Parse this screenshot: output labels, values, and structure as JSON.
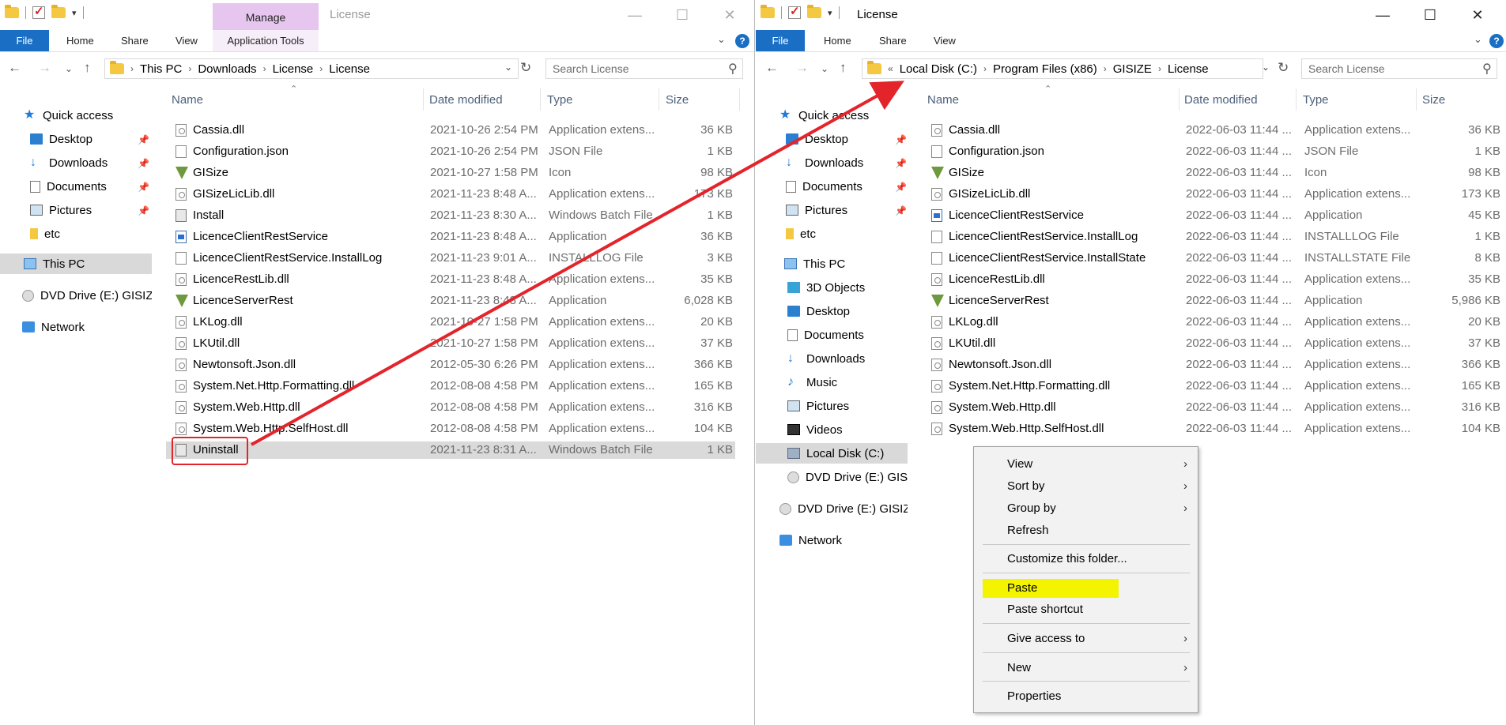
{
  "left": {
    "manage_tab": "Manage",
    "title": "License",
    "tabs": [
      "File",
      "Home",
      "Share",
      "View",
      "Application Tools"
    ],
    "breadcrumb": [
      "This PC",
      "Downloads",
      "License",
      "License"
    ],
    "search_placeholder": "Search License",
    "nav": [
      {
        "label": "Quick access",
        "icon": "star-icon"
      },
      {
        "label": "Desktop",
        "icon": "desktop-icon"
      },
      {
        "label": "Downloads",
        "icon": "downloads-icon"
      },
      {
        "label": "Documents",
        "icon": "documents-icon"
      },
      {
        "label": "Pictures",
        "icon": "pictures-icon"
      },
      {
        "label": "etc",
        "icon": "folder-icon"
      },
      {
        "label": "This PC",
        "icon": "this-pc-icon"
      },
      {
        "label": "DVD Drive (E:) GISIZE",
        "icon": "dvd-icon"
      },
      {
        "label": "Network",
        "icon": "network-icon"
      }
    ],
    "columns": [
      "Name",
      "Date modified",
      "Type",
      "Size"
    ],
    "files": [
      {
        "name": "Cassia.dll",
        "date": "2021-10-26 2:54 PM",
        "type": "Application extens...",
        "size": "36 KB",
        "icon": "dll"
      },
      {
        "name": "Configuration.json",
        "date": "2021-10-26 2:54 PM",
        "type": "JSON File",
        "size": "1 KB",
        "icon": "txt"
      },
      {
        "name": "GISize",
        "date": "2021-10-27 1:58 PM",
        "type": "Icon",
        "size": "98 KB",
        "icon": "tri"
      },
      {
        "name": "GISizeLicLib.dll",
        "date": "2021-11-23 8:48 A...",
        "type": "Application extens...",
        "size": "173 KB",
        "icon": "dll"
      },
      {
        "name": "Install",
        "date": "2021-11-23 8:30 A...",
        "type": "Windows Batch File",
        "size": "1 KB",
        "icon": "bat"
      },
      {
        "name": "LicenceClientRestService",
        "date": "2021-11-23 8:48 A...",
        "type": "Application",
        "size": "36 KB",
        "icon": "app"
      },
      {
        "name": "LicenceClientRestService.InstallLog",
        "date": "2021-11-23 9:01 A...",
        "type": "INSTALLLOG File",
        "size": "3 KB",
        "icon": "txt"
      },
      {
        "name": "LicenceRestLib.dll",
        "date": "2021-11-23 8:48 A...",
        "type": "Application extens...",
        "size": "35 KB",
        "icon": "dll"
      },
      {
        "name": "LicenceServerRest",
        "date": "2021-11-23 8:48 A...",
        "type": "Application",
        "size": "6,028 KB",
        "icon": "tri"
      },
      {
        "name": "LKLog.dll",
        "date": "2021-10-27 1:58 PM",
        "type": "Application extens...",
        "size": "20 KB",
        "icon": "dll"
      },
      {
        "name": "LKUtil.dll",
        "date": "2021-10-27 1:58 PM",
        "type": "Application extens...",
        "size": "37 KB",
        "icon": "dll"
      },
      {
        "name": "Newtonsoft.Json.dll",
        "date": "2012-05-30 6:26 PM",
        "type": "Application extens...",
        "size": "366 KB",
        "icon": "dll"
      },
      {
        "name": "System.Net.Http.Formatting.dll",
        "date": "2012-08-08 4:58 PM",
        "type": "Application extens...",
        "size": "165 KB",
        "icon": "dll"
      },
      {
        "name": "System.Web.Http.dll",
        "date": "2012-08-08 4:58 PM",
        "type": "Application extens...",
        "size": "316 KB",
        "icon": "dll"
      },
      {
        "name": "System.Web.Http.SelfHost.dll",
        "date": "2012-08-08 4:58 PM",
        "type": "Application extens...",
        "size": "104 KB",
        "icon": "dll"
      },
      {
        "name": "Uninstall",
        "date": "2021-11-23 8:31 A...",
        "type": "Windows Batch File",
        "size": "1 KB",
        "icon": "bat"
      }
    ]
  },
  "right": {
    "title": "License",
    "tabs": [
      "File",
      "Home",
      "Share",
      "View"
    ],
    "breadcrumb_prefix": "«",
    "breadcrumb": [
      "Local Disk (C:)",
      "Program Files (x86)",
      "GISIZE",
      "License"
    ],
    "search_placeholder": "Search License",
    "nav": [
      {
        "label": "Quick access",
        "icon": "star-icon"
      },
      {
        "label": "Desktop",
        "icon": "desktop-icon"
      },
      {
        "label": "Downloads",
        "icon": "downloads-icon"
      },
      {
        "label": "Documents",
        "icon": "documents-icon"
      },
      {
        "label": "Pictures",
        "icon": "pictures-icon"
      },
      {
        "label": "etc",
        "icon": "folder-icon"
      },
      {
        "label": "This PC",
        "icon": "this-pc-icon"
      },
      {
        "label": "3D Objects",
        "icon": "3d-objects-icon"
      },
      {
        "label": "Desktop",
        "icon": "desktop-icon"
      },
      {
        "label": "Documents",
        "icon": "documents-icon"
      },
      {
        "label": "Downloads",
        "icon": "downloads-icon"
      },
      {
        "label": "Music",
        "icon": "music-icon"
      },
      {
        "label": "Pictures",
        "icon": "pictures-icon"
      },
      {
        "label": "Videos",
        "icon": "videos-icon"
      },
      {
        "label": "Local Disk (C:)",
        "icon": "local-disk-icon"
      },
      {
        "label": "DVD Drive (E:) GISIZ",
        "icon": "dvd-icon"
      },
      {
        "label": "DVD Drive (E:) GISIZE",
        "icon": "dvd-icon"
      },
      {
        "label": "Network",
        "icon": "network-icon"
      }
    ],
    "columns": [
      "Name",
      "Date modified",
      "Type",
      "Size"
    ],
    "files": [
      {
        "name": "Cassia.dll",
        "date": "2022-06-03 11:44 ...",
        "type": "Application extens...",
        "size": "36 KB",
        "icon": "dll"
      },
      {
        "name": "Configuration.json",
        "date": "2022-06-03 11:44 ...",
        "type": "JSON File",
        "size": "1 KB",
        "icon": "txt"
      },
      {
        "name": "GISize",
        "date": "2022-06-03 11:44 ...",
        "type": "Icon",
        "size": "98 KB",
        "icon": "tri"
      },
      {
        "name": "GISizeLicLib.dll",
        "date": "2022-06-03 11:44 ...",
        "type": "Application extens...",
        "size": "173 KB",
        "icon": "dll"
      },
      {
        "name": "LicenceClientRestService",
        "date": "2022-06-03 11:44 ...",
        "type": "Application",
        "size": "45 KB",
        "icon": "app"
      },
      {
        "name": "LicenceClientRestService.InstallLog",
        "date": "2022-06-03 11:44 ...",
        "type": "INSTALLLOG File",
        "size": "1 KB",
        "icon": "txt"
      },
      {
        "name": "LicenceClientRestService.InstallState",
        "date": "2022-06-03 11:44 ...",
        "type": "INSTALLSTATE File",
        "size": "8 KB",
        "icon": "txt"
      },
      {
        "name": "LicenceRestLib.dll",
        "date": "2022-06-03 11:44 ...",
        "type": "Application extens...",
        "size": "35 KB",
        "icon": "dll"
      },
      {
        "name": "LicenceServerRest",
        "date": "2022-06-03 11:44 ...",
        "type": "Application",
        "size": "5,986 KB",
        "icon": "tri"
      },
      {
        "name": "LKLog.dll",
        "date": "2022-06-03 11:44 ...",
        "type": "Application extens...",
        "size": "20 KB",
        "icon": "dll"
      },
      {
        "name": "LKUtil.dll",
        "date": "2022-06-03 11:44 ...",
        "type": "Application extens...",
        "size": "37 KB",
        "icon": "dll"
      },
      {
        "name": "Newtonsoft.Json.dll",
        "date": "2022-06-03 11:44 ...",
        "type": "Application extens...",
        "size": "366 KB",
        "icon": "dll"
      },
      {
        "name": "System.Net.Http.Formatting.dll",
        "date": "2022-06-03 11:44 ...",
        "type": "Application extens...",
        "size": "165 KB",
        "icon": "dll"
      },
      {
        "name": "System.Web.Http.dll",
        "date": "2022-06-03 11:44 ...",
        "type": "Application extens...",
        "size": "316 KB",
        "icon": "dll"
      },
      {
        "name": "System.Web.Http.SelfHost.dll",
        "date": "2022-06-03 11:44 ...",
        "type": "Application extens...",
        "size": "104 KB",
        "icon": "dll"
      }
    ]
  },
  "context_menu": {
    "items": [
      {
        "label": "View",
        "submenu": true
      },
      {
        "label": "Sort by",
        "submenu": true
      },
      {
        "label": "Group by",
        "submenu": true
      },
      {
        "label": "Refresh",
        "submenu": false
      },
      {
        "label": "Customize this folder...",
        "submenu": false
      },
      {
        "label": "Paste",
        "submenu": false,
        "highlighted": true
      },
      {
        "label": "Paste shortcut",
        "submenu": false
      },
      {
        "label": "Give access to",
        "submenu": true
      },
      {
        "label": "New",
        "submenu": true
      },
      {
        "label": "Properties",
        "submenu": false
      }
    ]
  },
  "colors": {
    "file_tab": "#1a6fc4",
    "manage_tab": "#e6c6ee",
    "annotation_red": "#e3242b",
    "highlight_yellow": "#f4f400"
  }
}
